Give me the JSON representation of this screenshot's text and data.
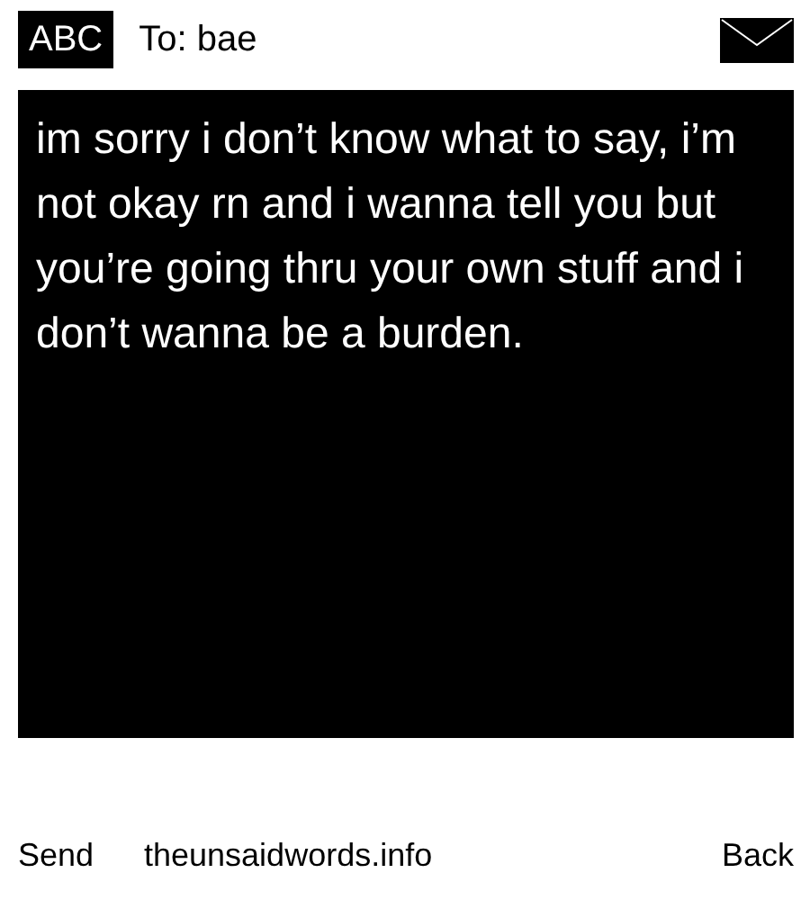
{
  "header": {
    "input_mode": "ABC",
    "recipient": "To: bae"
  },
  "message": {
    "text": "im sorry i don’t know what to say, i’m not okay rn and i wanna tell you but you’re going thru your own stuff and i don’t wanna be a burden."
  },
  "footer": {
    "left_softkey": "Send",
    "site": "theunsaidwords.info",
    "right_softkey": "Back"
  }
}
